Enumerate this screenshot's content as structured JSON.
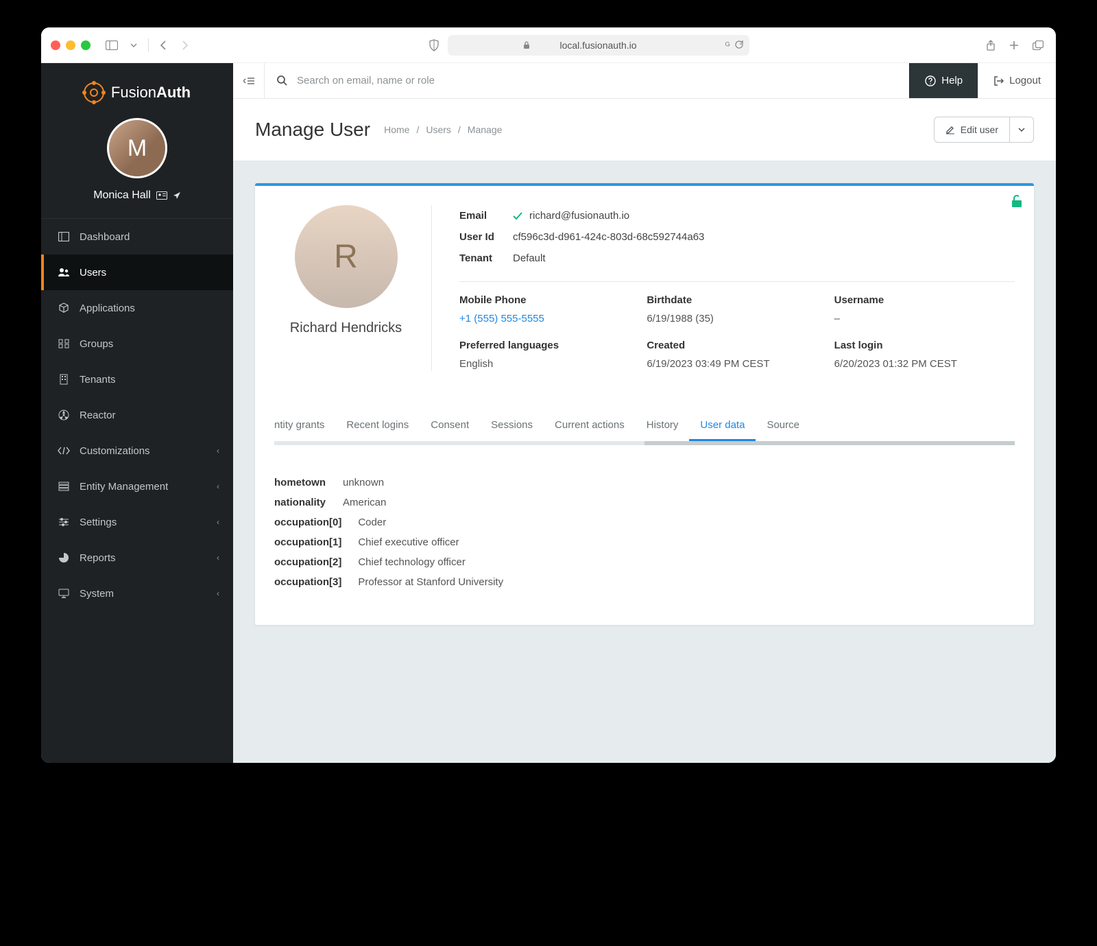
{
  "browser": {
    "url_display": "local.fusionauth.io"
  },
  "app_name": {
    "part1": "Fusion",
    "part2": "Auth"
  },
  "current_user": {
    "name": "Monica Hall",
    "initials": "M"
  },
  "search": {
    "placeholder": "Search on email, name or role"
  },
  "topbar": {
    "help": "Help",
    "logout": "Logout"
  },
  "sidebar": {
    "items": [
      {
        "label": "Dashboard",
        "expandable": false,
        "active": false
      },
      {
        "label": "Users",
        "expandable": false,
        "active": true
      },
      {
        "label": "Applications",
        "expandable": false,
        "active": false
      },
      {
        "label": "Groups",
        "expandable": false,
        "active": false
      },
      {
        "label": "Tenants",
        "expandable": false,
        "active": false
      },
      {
        "label": "Reactor",
        "expandable": false,
        "active": false
      },
      {
        "label": "Customizations",
        "expandable": true,
        "active": false
      },
      {
        "label": "Entity Management",
        "expandable": true,
        "active": false
      },
      {
        "label": "Settings",
        "expandable": true,
        "active": false
      },
      {
        "label": "Reports",
        "expandable": true,
        "active": false
      },
      {
        "label": "System",
        "expandable": true,
        "active": false
      }
    ]
  },
  "page": {
    "title": "Manage User",
    "breadcrumbs": [
      "Home",
      "Users",
      "Manage"
    ],
    "edit_button": "Edit user"
  },
  "user": {
    "display_name": "Richard Hendricks",
    "initials": "R",
    "email_label": "Email",
    "email": "richard@fusionauth.io",
    "user_id_label": "User Id",
    "user_id": "cf596c3d-d961-424c-803d-68c592744a63",
    "tenant_label": "Tenant",
    "tenant": "Default",
    "details": {
      "mobile_phone_label": "Mobile Phone",
      "mobile_phone": "+1 (555) 555-5555",
      "birthdate_label": "Birthdate",
      "birthdate": "6/19/1988 (35)",
      "username_label": "Username",
      "username": "–",
      "preferred_languages_label": "Preferred languages",
      "preferred_languages": "English",
      "created_label": "Created",
      "created": "6/19/2023 03:49 PM CEST",
      "last_login_label": "Last login",
      "last_login": "6/20/2023 01:32 PM CEST"
    }
  },
  "tabs": {
    "items": [
      {
        "label": "ntity grants",
        "active": false
      },
      {
        "label": "Recent logins",
        "active": false
      },
      {
        "label": "Consent",
        "active": false
      },
      {
        "label": "Sessions",
        "active": false
      },
      {
        "label": "Current actions",
        "active": false
      },
      {
        "label": "History",
        "active": false
      },
      {
        "label": "User data",
        "active": true
      },
      {
        "label": "Source",
        "active": false
      }
    ]
  },
  "user_data": [
    {
      "key": "hometown",
      "value": "unknown"
    },
    {
      "key": "nationality",
      "value": "American"
    },
    {
      "key": "occupation[0]",
      "value": "Coder"
    },
    {
      "key": "occupation[1]",
      "value": "Chief executive officer"
    },
    {
      "key": "occupation[2]",
      "value": "Chief technology officer"
    },
    {
      "key": "occupation[3]",
      "value": "Professor at Stanford University"
    }
  ]
}
